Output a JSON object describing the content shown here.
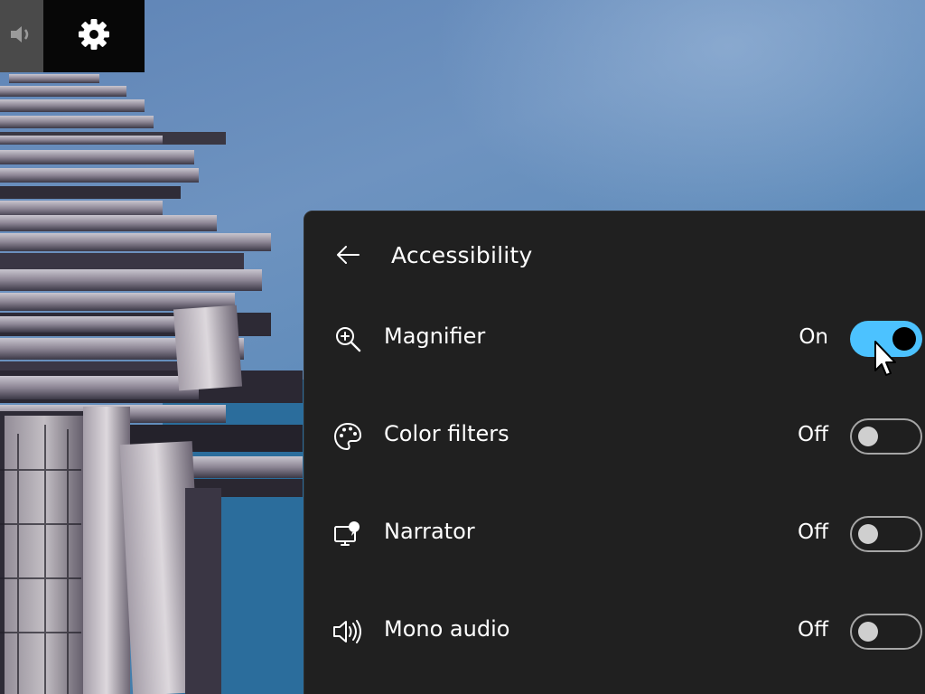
{
  "tray": {
    "buttons": [
      {
        "icon": "volume-icon"
      },
      {
        "icon": "gear-icon"
      }
    ]
  },
  "panel": {
    "title": "Accessibility",
    "back_icon": "arrow-left-icon",
    "items": [
      {
        "label": "Magnifier",
        "state": "On",
        "icon": "magnifier-icon",
        "on": true
      },
      {
        "label": "Color filters",
        "state": "Off",
        "icon": "palette-icon",
        "on": false
      },
      {
        "label": "Narrator",
        "state": "Off",
        "icon": "narrator-icon",
        "on": false
      },
      {
        "label": "Mono audio",
        "state": "Off",
        "icon": "mono-audio-icon",
        "on": false
      }
    ]
  },
  "colors": {
    "accent": "#4cc2ff",
    "panel_bg": "#202020",
    "toggle_off_border": "#a6a6a6"
  }
}
